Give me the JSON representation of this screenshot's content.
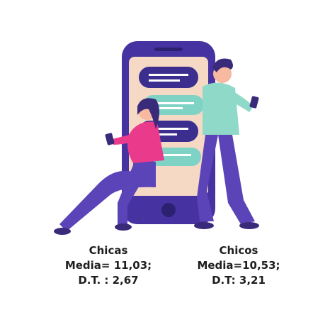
{
  "groups": {
    "girls": {
      "label": "Chicas",
      "mean": "Media= 11,03;",
      "sd": "D.T. : 2,67"
    },
    "boys": {
      "label": "Chicos",
      "mean": "Media=10,53;",
      "sd": "D.T: 3,21"
    }
  },
  "colors": {
    "phone_frame": "#4632a0",
    "phone_screen": "#f6d9c4",
    "bubble_dark": "#3b2e8f",
    "bubble_teal": "#7fd3c4",
    "girl_top": "#ea3a8c",
    "boy_shirt": "#8fd9c8",
    "pants": "#5b43b8",
    "skin": "#f7b9a0",
    "hair": "#3a2a7a"
  },
  "icons": [
    "smartphone-illustration",
    "girl-figure",
    "boy-figure"
  ]
}
